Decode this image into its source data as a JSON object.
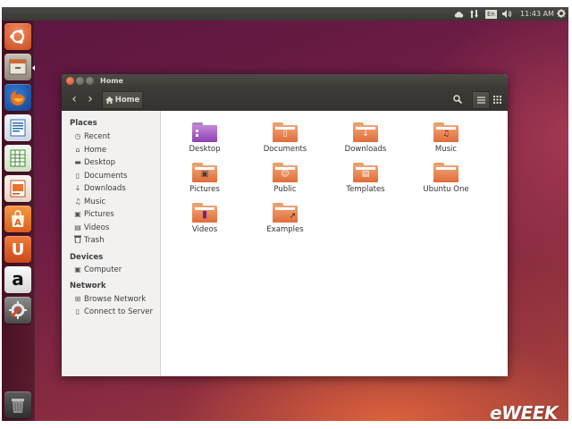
{
  "top_panel": {
    "keyboard_layout": "En",
    "time": "11:43 AM",
    "icons": [
      "cloud-icon",
      "network-icon",
      "volume-icon",
      "gear-icon"
    ]
  },
  "launcher": {
    "items": [
      {
        "name": "dash-home",
        "icon": "ubuntu-logo-icon"
      },
      {
        "name": "files",
        "icon": "file-cabinet-icon"
      },
      {
        "name": "firefox",
        "icon": "firefox-icon"
      },
      {
        "name": "libreoffice-writer",
        "icon": "writer-icon"
      },
      {
        "name": "libreoffice-calc",
        "icon": "calc-icon"
      },
      {
        "name": "libreoffice-impress",
        "icon": "impress-icon"
      },
      {
        "name": "software-center",
        "icon": "shopping-bag-icon"
      },
      {
        "name": "ubuntu-one",
        "icon": "ubuntu-one-icon",
        "glyph": "U"
      },
      {
        "name": "amazon",
        "icon": "amazon-icon",
        "glyph": "a"
      },
      {
        "name": "system-settings",
        "icon": "settings-icon"
      },
      {
        "name": "trash",
        "icon": "trash-icon"
      }
    ]
  },
  "window": {
    "title": "Home",
    "toolbar": {
      "back_icon": "‹",
      "forward_icon": "›",
      "location_label": "Home",
      "search_icon": "search-icon",
      "list_view_icon": "list-icon",
      "grid_view_icon": "grid-icon"
    },
    "sidebar": {
      "sections": [
        {
          "heading": "Places",
          "items": [
            {
              "label": "Recent",
              "icon": "◷"
            },
            {
              "label": "Home",
              "icon": "⌂"
            },
            {
              "label": "Desktop",
              "icon": "▬"
            },
            {
              "label": "Documents",
              "icon": "▯"
            },
            {
              "label": "Downloads",
              "icon": "↓"
            },
            {
              "label": "Music",
              "icon": "♫"
            },
            {
              "label": "Pictures",
              "icon": "▣"
            },
            {
              "label": "Videos",
              "icon": "▤"
            },
            {
              "label": "Trash",
              "icon": "🗑"
            }
          ]
        },
        {
          "heading": "Devices",
          "items": [
            {
              "label": "Computer",
              "icon": "▣"
            }
          ]
        },
        {
          "heading": "Network",
          "items": [
            {
              "label": "Browse Network",
              "icon": "⊞"
            },
            {
              "label": "Connect to Server",
              "icon": "▯"
            }
          ]
        }
      ]
    },
    "files": [
      {
        "label": "Desktop",
        "emblem": "",
        "special": "desktop"
      },
      {
        "label": "Documents",
        "emblem": "▯"
      },
      {
        "label": "Downloads",
        "emblem": "↓"
      },
      {
        "label": "Music",
        "emblem": "♫"
      },
      {
        "label": "Pictures",
        "emblem": "▣"
      },
      {
        "label": "Public",
        "emblem": "☺"
      },
      {
        "label": "Templates",
        "emblem": "▤"
      },
      {
        "label": "Ubuntu One",
        "emblem": ""
      },
      {
        "label": "Videos",
        "emblem": "▮"
      },
      {
        "label": "Examples",
        "emblem": "↗"
      }
    ]
  },
  "watermark": "eWEEK"
}
